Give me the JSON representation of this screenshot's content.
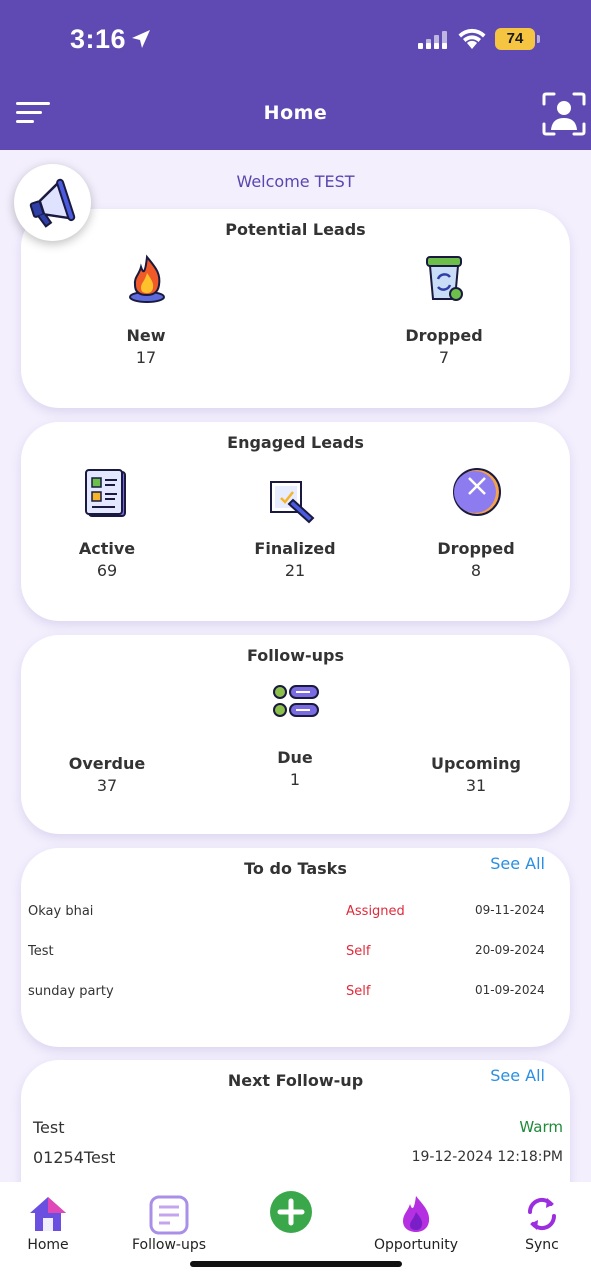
{
  "status_bar": {
    "time": "3:16",
    "battery": "74"
  },
  "header": {
    "title": "Home"
  },
  "welcome": "Welcome TEST",
  "potential_leads": {
    "title": "Potential Leads",
    "items": [
      {
        "label": "New",
        "value": "17",
        "icon": "fire-icon"
      },
      {
        "label": "Dropped",
        "value": "7",
        "icon": "recycle-bin-icon"
      }
    ]
  },
  "engaged_leads": {
    "title": "Engaged Leads",
    "items": [
      {
        "label": "Active",
        "value": "69",
        "icon": "checklist-icon"
      },
      {
        "label": "Finalized",
        "value": "21",
        "icon": "sign-document-icon"
      },
      {
        "label": "Dropped",
        "value": "8",
        "icon": "dropped-circle-icon"
      }
    ]
  },
  "followups": {
    "title": "Follow-ups",
    "items": [
      {
        "label": "Overdue",
        "value": "37"
      },
      {
        "label": "Due",
        "value": "1"
      },
      {
        "label": "Upcoming",
        "value": "31"
      }
    ]
  },
  "todo": {
    "title": "To do Tasks",
    "see_all": "See All",
    "rows": [
      {
        "name": "Okay bhai",
        "type": "Assigned",
        "date": "09-11-2024"
      },
      {
        "name": "Test",
        "type": "Self",
        "date": "20-09-2024"
      },
      {
        "name": "sunday party",
        "type": "Self",
        "date": "01-09-2024"
      }
    ]
  },
  "next_followup": {
    "title": "Next Follow-up",
    "see_all": "See All",
    "name": "Test",
    "status": "Warm",
    "id": "01254Test",
    "datetime": "19-12-2024 12:18:PM"
  },
  "tabbar": {
    "items": [
      {
        "label": "Home",
        "icon": "home-icon"
      },
      {
        "label": "Follow-ups",
        "icon": "notes-icon"
      },
      {
        "label": "",
        "icon": "add-icon"
      },
      {
        "label": "Opportunity",
        "icon": "flame-icon"
      },
      {
        "label": "Sync",
        "icon": "sync-icon"
      }
    ]
  },
  "colors": {
    "header": "#5e4ab2",
    "background": "#f3effd",
    "see_all": "#2a8fe0",
    "task_type": "#e02a3a",
    "warm": "#1f8a3a",
    "add_button": "#3aa84a"
  }
}
